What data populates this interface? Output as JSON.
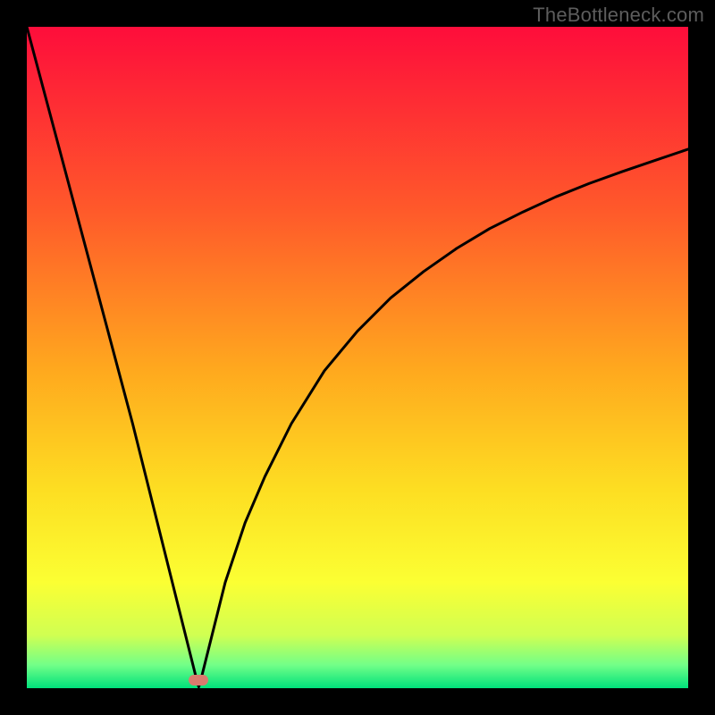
{
  "watermark": "TheBottleneck.com",
  "colors": {
    "frame": "#000000",
    "marker": "#da7b6e",
    "curve": "#000000",
    "gradient_stops": [
      {
        "offset": 0.0,
        "color": "#fe0d3b"
      },
      {
        "offset": 0.28,
        "color": "#ff5a2a"
      },
      {
        "offset": 0.52,
        "color": "#ffa91e"
      },
      {
        "offset": 0.7,
        "color": "#fdde22"
      },
      {
        "offset": 0.84,
        "color": "#fbff33"
      },
      {
        "offset": 0.92,
        "color": "#d0ff52"
      },
      {
        "offset": 0.965,
        "color": "#72ff88"
      },
      {
        "offset": 1.0,
        "color": "#00e17b"
      }
    ]
  },
  "chart_data": {
    "type": "line",
    "title": "",
    "xlabel": "",
    "ylabel": "",
    "xlim": [
      0,
      100
    ],
    "ylim": [
      0,
      100
    ],
    "notes": "V-shaped bottleneck curve touching y≈0 near x≈26; left branch nearly linear to top-left corner; right branch concave, reaching y≈82 at x=100.",
    "marker": {
      "x": 26,
      "y": 1.2
    },
    "series": [
      {
        "name": "bottleneck-curve",
        "x": [
          0,
          4,
          8,
          12,
          16,
          20,
          23,
          25,
          25.8,
          26,
          26.2,
          27,
          28,
          30,
          33,
          36,
          40,
          45,
          50,
          55,
          60,
          65,
          70,
          75,
          80,
          85,
          90,
          95,
          100
        ],
        "y": [
          100,
          85,
          70,
          55,
          40,
          24,
          12,
          4,
          0.8,
          0.2,
          0.8,
          4,
          8,
          16,
          25,
          32,
          40,
          48,
          54,
          59,
          63,
          66.5,
          69.5,
          72,
          74.3,
          76.3,
          78.1,
          79.8,
          81.5
        ]
      }
    ]
  }
}
